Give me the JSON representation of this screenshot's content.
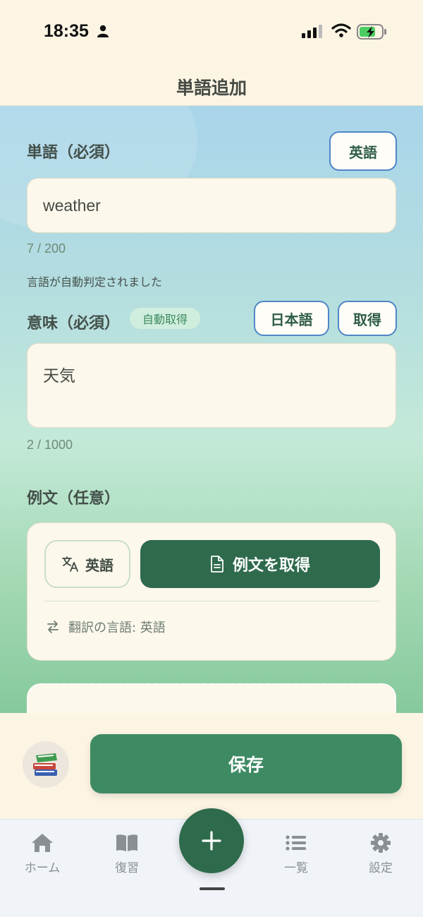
{
  "status": {
    "time": "18:35"
  },
  "header": {
    "title": "単語追加"
  },
  "word": {
    "label": "単語（必須）",
    "language_button": "英語",
    "value": "weather",
    "counter": "7 / 200",
    "hint": "言語が自動判定されました"
  },
  "meaning": {
    "label": "意味（必須）",
    "badge": "自動取得",
    "language_button": "日本語",
    "fetch_button": "取得",
    "value": "天気",
    "counter": "2 / 1000"
  },
  "example": {
    "label": "例文（任意）",
    "language_chip": "英語",
    "fetch_button": "例文を取得",
    "translation_label": "翻訳の言語: 英語"
  },
  "save": {
    "button": "保存"
  },
  "tabs": [
    {
      "label": "ホーム",
      "icon": "home-icon"
    },
    {
      "label": "復習",
      "icon": "book-icon"
    },
    {
      "label": "一覧",
      "icon": "list-icon"
    },
    {
      "label": "設定",
      "icon": "gear-icon"
    }
  ],
  "colors": {
    "primary": "#2f6a4d",
    "save": "#3d8a63",
    "accent_border": "#4f86c6",
    "background": "#fdf5e4"
  }
}
